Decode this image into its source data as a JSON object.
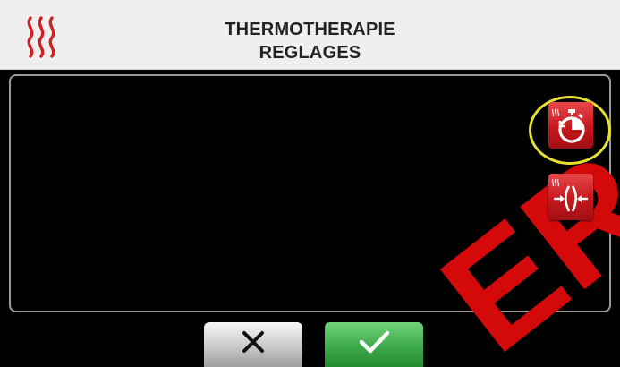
{
  "header": {
    "title_line1": "THERMOTHERAPIE",
    "title_line2": "REGLAGES",
    "icon": "heat-waves-icon"
  },
  "side_buttons": [
    {
      "name": "timer-settings-button",
      "icon": "timer-icon",
      "highlighted": true
    },
    {
      "name": "compression-settings-button",
      "icon": "compression-icon",
      "highlighted": false
    }
  ],
  "footer": {
    "cancel_icon": "close-icon",
    "confirm_icon": "checkmark-icon"
  },
  "watermark_text": "ER",
  "colors": {
    "accent_red": "#c6181d",
    "highlight_yellow": "#e7e030",
    "confirm_green": "#3ea94a"
  }
}
